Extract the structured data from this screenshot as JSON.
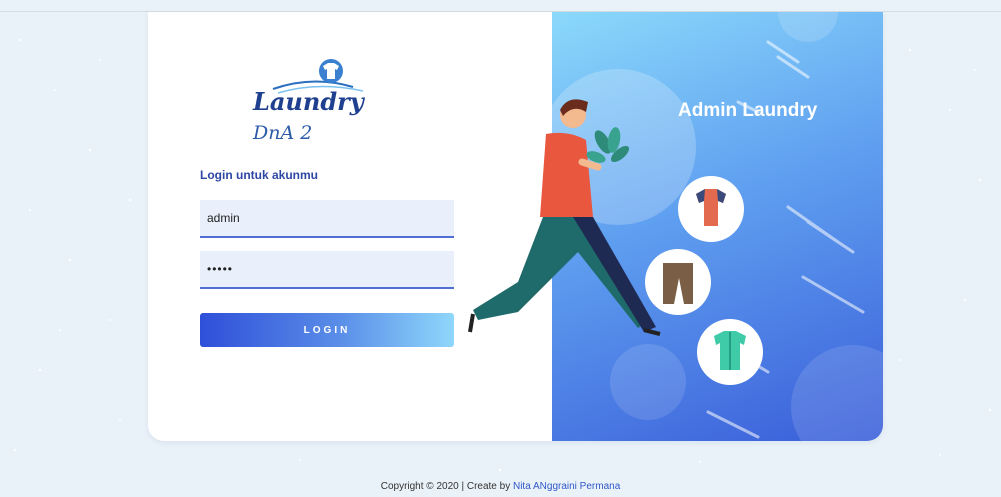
{
  "brand": {
    "logo_text": "Laundry",
    "logo_suffix": "DnA 2"
  },
  "login": {
    "heading": "Login untuk akunmu",
    "username_value": "admin",
    "password_value": "•••••",
    "button_label": "LOGIN"
  },
  "hero": {
    "title": "Admin Laundry"
  },
  "footer": {
    "copyright": "Copyright © 2020 | Create by ",
    "author": "Nita ANggraini Permana"
  },
  "colors": {
    "accent": "#2e47a4",
    "button_start": "#2f4fd9",
    "button_end": "#8fd7fb",
    "panel_top": "#8bd9fb",
    "panel_bottom": "#3a5ed9"
  },
  "icons": [
    "t-shirt-icon",
    "pants-icon",
    "shirt-icon",
    "plant-icon"
  ]
}
